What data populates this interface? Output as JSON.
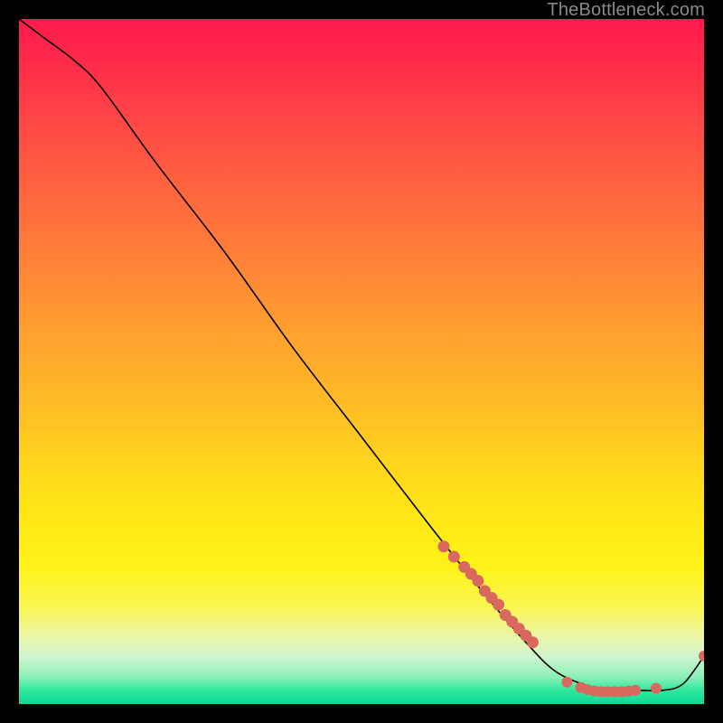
{
  "watermark": "TheBottleneck.com",
  "chart_data": {
    "type": "line",
    "title": "",
    "xlabel": "",
    "ylabel": "",
    "xlim": [
      0,
      100
    ],
    "ylim": [
      0,
      100
    ],
    "curve": {
      "x": [
        0,
        4,
        8,
        12,
        20,
        30,
        40,
        50,
        60,
        68,
        74,
        78,
        82,
        86,
        90,
        94,
        97,
        100
      ],
      "y": [
        100,
        97,
        94,
        90,
        79,
        66,
        52,
        39,
        26,
        16,
        9,
        5,
        3,
        2,
        2,
        2,
        3,
        7
      ]
    },
    "dots": {
      "cluster_slope": {
        "x": [
          62,
          63.5,
          65,
          66,
          67,
          68,
          69,
          70,
          71,
          72,
          73,
          74,
          75
        ],
        "y": [
          23,
          21.5,
          20,
          19,
          18,
          16.5,
          15.5,
          14.5,
          13,
          12,
          11,
          10,
          9
        ]
      },
      "cluster_trough": {
        "x": [
          80,
          82,
          83,
          84,
          85,
          86,
          87,
          88,
          89,
          90,
          93
        ],
        "y": [
          3.2,
          2.4,
          2.1,
          1.9,
          1.8,
          1.8,
          1.8,
          1.8,
          1.9,
          2.0,
          2.3
        ]
      },
      "end_point": {
        "x": 100,
        "y": 7
      }
    },
    "dot_color": "#d9695e",
    "curve_color": "#000000"
  }
}
